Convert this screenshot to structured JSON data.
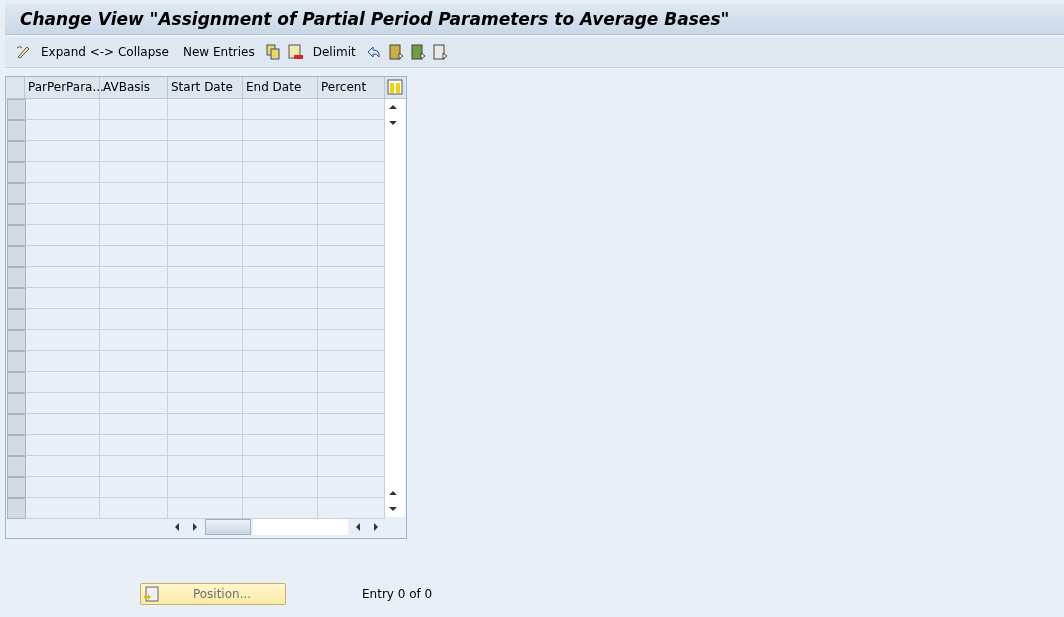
{
  "window": {
    "title": "Change View \"Assignment of Partial Period Parameters to Average Bases\""
  },
  "toolbar": {
    "buttons": [
      "Expand <-> Collapse",
      "New Entries",
      "Delimit"
    ]
  },
  "table": {
    "columns": [
      "ParPerPara...",
      "AVBasis",
      "Start Date",
      "End Date",
      "Percent"
    ]
  },
  "footer": {
    "position_button": "Position...",
    "entry_count": "Entry 0 of 0"
  }
}
